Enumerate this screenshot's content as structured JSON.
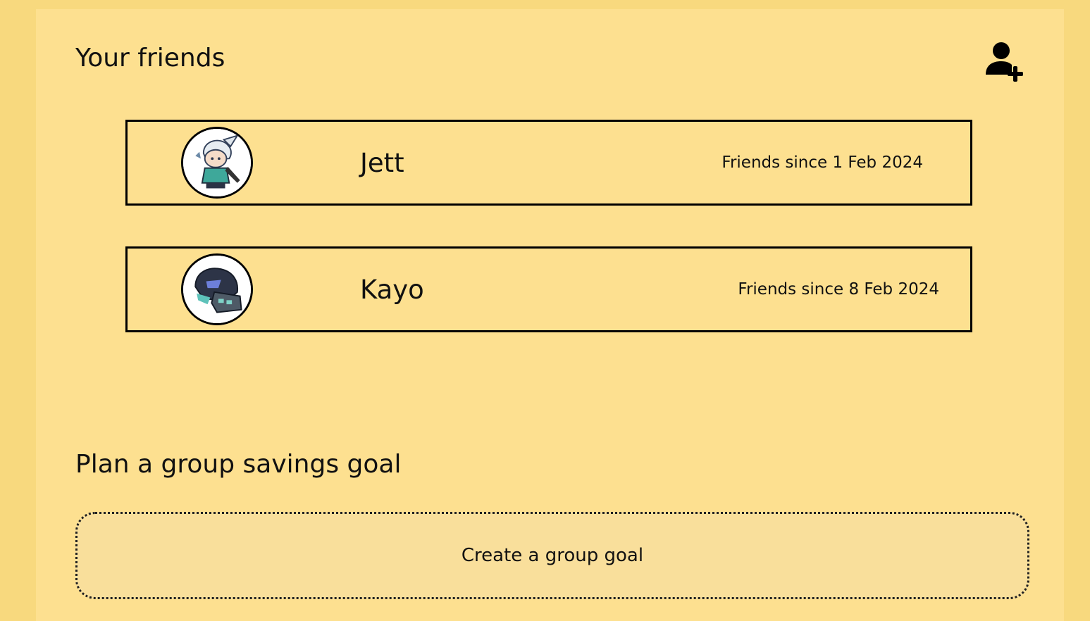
{
  "friends_section": {
    "title": "Your friends",
    "add_icon": "add-user-icon"
  },
  "friends": [
    {
      "name": "Jett",
      "since": "Friends since 1 Feb 2024",
      "avatar": "jett-avatar"
    },
    {
      "name": "Kayo",
      "since": "Friends since 8 Feb 2024",
      "avatar": "kayo-avatar"
    }
  ],
  "group_section": {
    "title": "Plan a group savings goal",
    "create_label": "Create a group goal"
  },
  "colors": {
    "background": "#f8d97e",
    "panel": "#fde090",
    "create_button": "#f9df9b",
    "border": "#000000"
  }
}
